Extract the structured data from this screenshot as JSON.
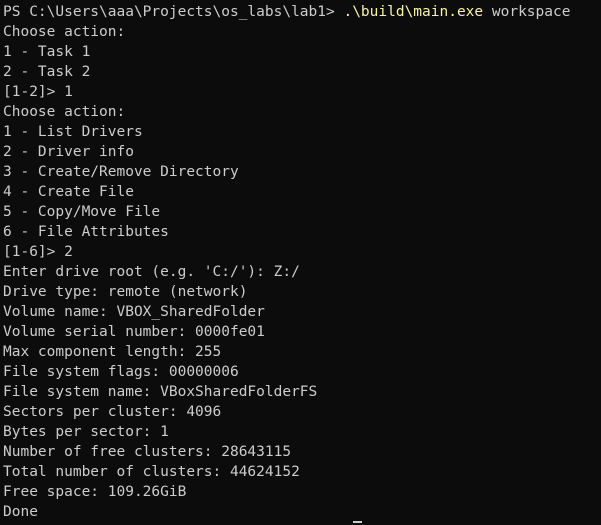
{
  "terminal": {
    "prompt": "PS C:\\Users\\aaa\\Projects\\os_labs\\lab1> ",
    "command_exe": ".\\build\\main.exe",
    "command_arg": " workspace",
    "lines": [
      "Choose action:",
      "1 - Task 1",
      "2 - Task 2",
      "[1-2]> 1",
      "Choose action:",
      "1 - List Drivers",
      "2 - Driver info",
      "3 - Create/Remove Directory",
      "4 - Create File",
      "5 - Copy/Move File",
      "6 - File Attributes",
      "[1-6]> 2",
      "Enter drive root (e.g. 'C:/'): Z:/",
      "Drive type: remote (network)",
      "Volume name: VBOX_SharedFolder",
      "Volume serial number: 0000fe01",
      "Max component length: 255",
      "File system flags: 00000006",
      "File system name: VBoxSharedFolderFS",
      "Sectors per cluster: 4096",
      "Bytes per sector: 1",
      "Number of free clusters: 28643115",
      "Total number of clusters: 44624152",
      "Free space: 109.26GiB",
      "Done"
    ]
  },
  "colors": {
    "background": "#0c0c0c",
    "text": "#cccccc",
    "command_highlight": "#f9f1a5"
  }
}
